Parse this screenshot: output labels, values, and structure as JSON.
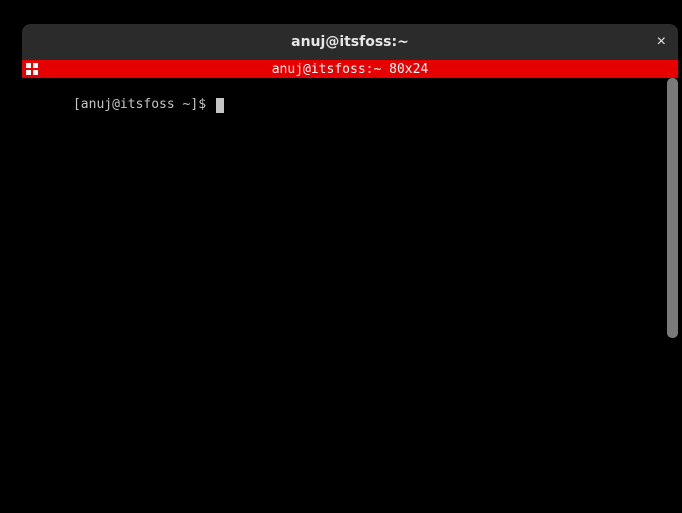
{
  "titlebar": {
    "title": "anuj@itsfoss:~",
    "close_label": "×"
  },
  "tabbar": {
    "title": "anuj@itsfoss:~ 80x24"
  },
  "terminal": {
    "prompt": "[anuj@itsfoss ~]$ "
  }
}
